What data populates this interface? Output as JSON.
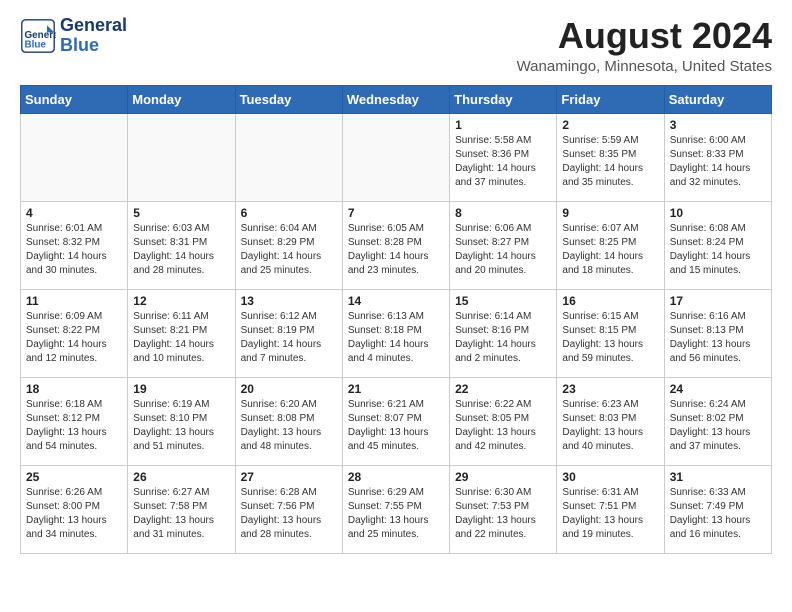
{
  "header": {
    "logo_line1": "General",
    "logo_line2": "Blue",
    "month_year": "August 2024",
    "location": "Wanamingo, Minnesota, United States"
  },
  "weekdays": [
    "Sunday",
    "Monday",
    "Tuesday",
    "Wednesday",
    "Thursday",
    "Friday",
    "Saturday"
  ],
  "weeks": [
    [
      {
        "day": "",
        "info": ""
      },
      {
        "day": "",
        "info": ""
      },
      {
        "day": "",
        "info": ""
      },
      {
        "day": "",
        "info": ""
      },
      {
        "day": "1",
        "info": "Sunrise: 5:58 AM\nSunset: 8:36 PM\nDaylight: 14 hours\nand 37 minutes."
      },
      {
        "day": "2",
        "info": "Sunrise: 5:59 AM\nSunset: 8:35 PM\nDaylight: 14 hours\nand 35 minutes."
      },
      {
        "day": "3",
        "info": "Sunrise: 6:00 AM\nSunset: 8:33 PM\nDaylight: 14 hours\nand 32 minutes."
      }
    ],
    [
      {
        "day": "4",
        "info": "Sunrise: 6:01 AM\nSunset: 8:32 PM\nDaylight: 14 hours\nand 30 minutes."
      },
      {
        "day": "5",
        "info": "Sunrise: 6:03 AM\nSunset: 8:31 PM\nDaylight: 14 hours\nand 28 minutes."
      },
      {
        "day": "6",
        "info": "Sunrise: 6:04 AM\nSunset: 8:29 PM\nDaylight: 14 hours\nand 25 minutes."
      },
      {
        "day": "7",
        "info": "Sunrise: 6:05 AM\nSunset: 8:28 PM\nDaylight: 14 hours\nand 23 minutes."
      },
      {
        "day": "8",
        "info": "Sunrise: 6:06 AM\nSunset: 8:27 PM\nDaylight: 14 hours\nand 20 minutes."
      },
      {
        "day": "9",
        "info": "Sunrise: 6:07 AM\nSunset: 8:25 PM\nDaylight: 14 hours\nand 18 minutes."
      },
      {
        "day": "10",
        "info": "Sunrise: 6:08 AM\nSunset: 8:24 PM\nDaylight: 14 hours\nand 15 minutes."
      }
    ],
    [
      {
        "day": "11",
        "info": "Sunrise: 6:09 AM\nSunset: 8:22 PM\nDaylight: 14 hours\nand 12 minutes."
      },
      {
        "day": "12",
        "info": "Sunrise: 6:11 AM\nSunset: 8:21 PM\nDaylight: 14 hours\nand 10 minutes."
      },
      {
        "day": "13",
        "info": "Sunrise: 6:12 AM\nSunset: 8:19 PM\nDaylight: 14 hours\nand 7 minutes."
      },
      {
        "day": "14",
        "info": "Sunrise: 6:13 AM\nSunset: 8:18 PM\nDaylight: 14 hours\nand 4 minutes."
      },
      {
        "day": "15",
        "info": "Sunrise: 6:14 AM\nSunset: 8:16 PM\nDaylight: 14 hours\nand 2 minutes."
      },
      {
        "day": "16",
        "info": "Sunrise: 6:15 AM\nSunset: 8:15 PM\nDaylight: 13 hours\nand 59 minutes."
      },
      {
        "day": "17",
        "info": "Sunrise: 6:16 AM\nSunset: 8:13 PM\nDaylight: 13 hours\nand 56 minutes."
      }
    ],
    [
      {
        "day": "18",
        "info": "Sunrise: 6:18 AM\nSunset: 8:12 PM\nDaylight: 13 hours\nand 54 minutes."
      },
      {
        "day": "19",
        "info": "Sunrise: 6:19 AM\nSunset: 8:10 PM\nDaylight: 13 hours\nand 51 minutes."
      },
      {
        "day": "20",
        "info": "Sunrise: 6:20 AM\nSunset: 8:08 PM\nDaylight: 13 hours\nand 48 minutes."
      },
      {
        "day": "21",
        "info": "Sunrise: 6:21 AM\nSunset: 8:07 PM\nDaylight: 13 hours\nand 45 minutes."
      },
      {
        "day": "22",
        "info": "Sunrise: 6:22 AM\nSunset: 8:05 PM\nDaylight: 13 hours\nand 42 minutes."
      },
      {
        "day": "23",
        "info": "Sunrise: 6:23 AM\nSunset: 8:03 PM\nDaylight: 13 hours\nand 40 minutes."
      },
      {
        "day": "24",
        "info": "Sunrise: 6:24 AM\nSunset: 8:02 PM\nDaylight: 13 hours\nand 37 minutes."
      }
    ],
    [
      {
        "day": "25",
        "info": "Sunrise: 6:26 AM\nSunset: 8:00 PM\nDaylight: 13 hours\nand 34 minutes."
      },
      {
        "day": "26",
        "info": "Sunrise: 6:27 AM\nSunset: 7:58 PM\nDaylight: 13 hours\nand 31 minutes."
      },
      {
        "day": "27",
        "info": "Sunrise: 6:28 AM\nSunset: 7:56 PM\nDaylight: 13 hours\nand 28 minutes."
      },
      {
        "day": "28",
        "info": "Sunrise: 6:29 AM\nSunset: 7:55 PM\nDaylight: 13 hours\nand 25 minutes."
      },
      {
        "day": "29",
        "info": "Sunrise: 6:30 AM\nSunset: 7:53 PM\nDaylight: 13 hours\nand 22 minutes."
      },
      {
        "day": "30",
        "info": "Sunrise: 6:31 AM\nSunset: 7:51 PM\nDaylight: 13 hours\nand 19 minutes."
      },
      {
        "day": "31",
        "info": "Sunrise: 6:33 AM\nSunset: 7:49 PM\nDaylight: 13 hours\nand 16 minutes."
      }
    ]
  ]
}
